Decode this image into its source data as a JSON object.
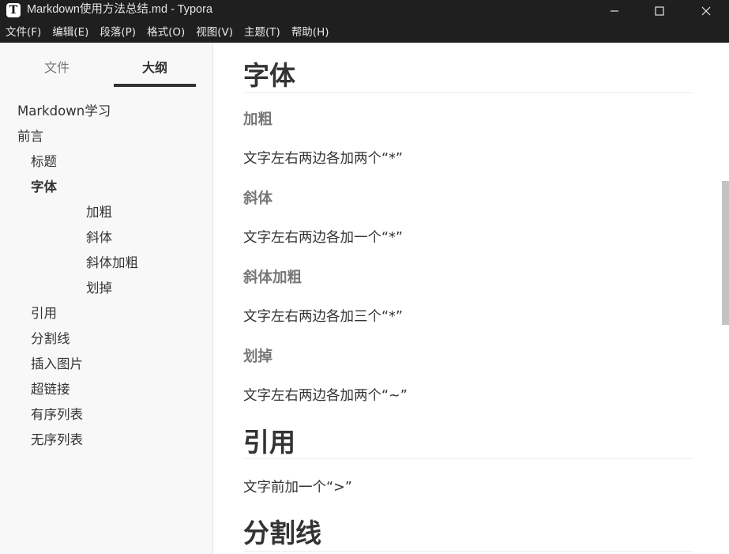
{
  "window": {
    "title": "Markdown使用方法总结.md - Typora",
    "app_icon_letter": "T"
  },
  "menubar": {
    "items": [
      "文件(F)",
      "编辑(E)",
      "段落(P)",
      "格式(O)",
      "视图(V)",
      "主题(T)",
      "帮助(H)"
    ]
  },
  "sidebar": {
    "tabs": {
      "files": "文件",
      "outline": "大纲"
    },
    "active_tab": "outline",
    "outline": [
      {
        "label": "Markdown学习",
        "level": 1,
        "active": false
      },
      {
        "label": "前言",
        "level": 1,
        "active": false
      },
      {
        "label": "标题",
        "level": 2,
        "active": false
      },
      {
        "label": "字体",
        "level": 2,
        "active": true
      },
      {
        "label": "加粗",
        "level": 4,
        "active": false
      },
      {
        "label": "斜体",
        "level": 4,
        "active": false
      },
      {
        "label": "斜体加粗",
        "level": 4,
        "active": false
      },
      {
        "label": "划掉",
        "level": 4,
        "active": false
      },
      {
        "label": "引用",
        "level": 2,
        "active": false
      },
      {
        "label": "分割线",
        "level": 2,
        "active": false
      },
      {
        "label": "插入图片",
        "level": 2,
        "active": false
      },
      {
        "label": "超链接",
        "level": 2,
        "active": false
      },
      {
        "label": "有序列表",
        "level": 2,
        "active": false
      },
      {
        "label": "无序列表",
        "level": 2,
        "active": false
      }
    ]
  },
  "document": {
    "blocks": [
      {
        "type": "h2",
        "text": "字体"
      },
      {
        "type": "h4",
        "text": "加粗"
      },
      {
        "type": "p",
        "text": "文字左右两边各加两个“*”"
      },
      {
        "type": "h4",
        "text": "斜体"
      },
      {
        "type": "p",
        "text": "文字左右两边各加一个“*”"
      },
      {
        "type": "h4",
        "text": "斜体加粗"
      },
      {
        "type": "p",
        "text": "文字左右两边各加三个“*”"
      },
      {
        "type": "h4",
        "text": "划掉"
      },
      {
        "type": "p",
        "text": "文字左右两边各加两个“~”"
      },
      {
        "type": "h2",
        "text": "引用"
      },
      {
        "type": "p",
        "text": "文字前加一个“>”"
      },
      {
        "type": "h2",
        "text": "分割线"
      }
    ]
  },
  "colors": {
    "titlebar_bg": "#1f1f1f",
    "sidebar_bg": "#f8f8f8",
    "heading_text": "#333333",
    "subheading_text": "#777777",
    "scrollbar_thumb": "#c2c2c2"
  }
}
